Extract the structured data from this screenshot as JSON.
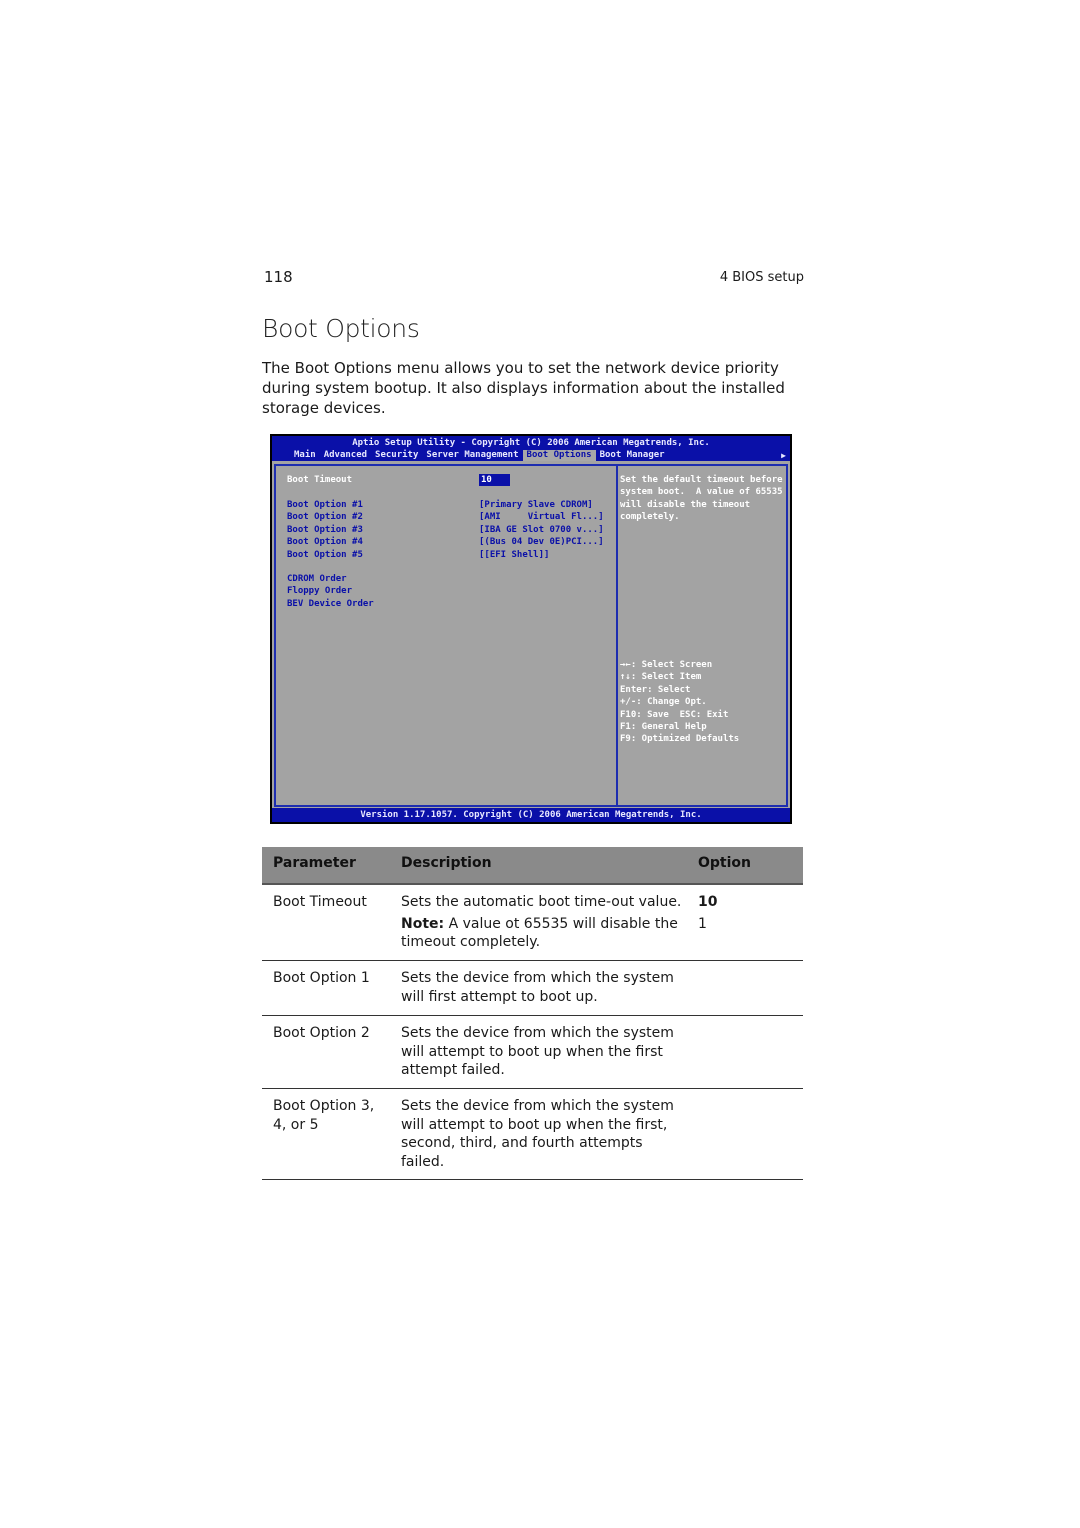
{
  "header": {
    "page_number": "118",
    "chapter": "4 BIOS setup"
  },
  "title": "Boot Options",
  "intro": "The Boot Options menu allows you to set the network device priority during system bootup. It also displays information about the installed storage devices.",
  "bios": {
    "title": "Aptio Setup Utility - Copyright (C) 2006 American Megatrends, Inc.",
    "tabs": [
      "Main",
      "Advanced",
      "Security",
      "Server Management",
      "Boot Options",
      "Boot Manager"
    ],
    "active_tab": "Boot Options",
    "items": [
      {
        "label": "Boot Timeout",
        "value": "10"
      },
      {
        "label": "Boot Option #1",
        "value": "[Primary Slave CDROM]"
      },
      {
        "label": "Boot Option #2",
        "value": "[AMI     Virtual Fl...]"
      },
      {
        "label": "Boot Option #3",
        "value": "[IBA GE Slot 0700 v...]"
      },
      {
        "label": "Boot Option #4",
        "value": "[(Bus 04 Dev 0E)PCI...]"
      },
      {
        "label": "Boot Option #5",
        "value": "[[EFI Shell]]"
      }
    ],
    "submenus": [
      "CDROM Order",
      "Floppy Order",
      "BEV Device Order"
    ],
    "help_text": [
      "Set the default timeout before",
      "system boot.  A value of 65535",
      "will disable the timeout",
      "completely."
    ],
    "keys": [
      "→←: Select Screen",
      "↑↓: Select Item",
      "Enter: Select",
      "+/-: Change Opt.",
      "F10: Save  ESC: Exit",
      "F1: General Help",
      "F9: Optimized Defaults"
    ],
    "footer": "Version 1.17.1057. Copyright (C) 2006 American Megatrends, Inc."
  },
  "table": {
    "headers": {
      "parameter": "Parameter",
      "description": "Description",
      "option": "Option"
    },
    "rows": [
      {
        "parameter": "Boot Timeout",
        "description": "Sets the automatic boot time-out value.",
        "note_label": "Note:",
        "note": " A value ot 65535 will disable the timeout completely.",
        "options": [
          "10",
          "1"
        ]
      },
      {
        "parameter": "Boot Option 1",
        "description": "Sets the device from which the system will first attempt to boot up."
      },
      {
        "parameter": "Boot Option 2",
        "description": "Sets the device from which the system will attempt to boot up when the first attempt failed."
      },
      {
        "parameter": "Boot Option 3, 4, or 5",
        "description": "Sets the device from which the system will attempt to boot up when the first, second, third, and fourth attempts failed."
      }
    ]
  }
}
